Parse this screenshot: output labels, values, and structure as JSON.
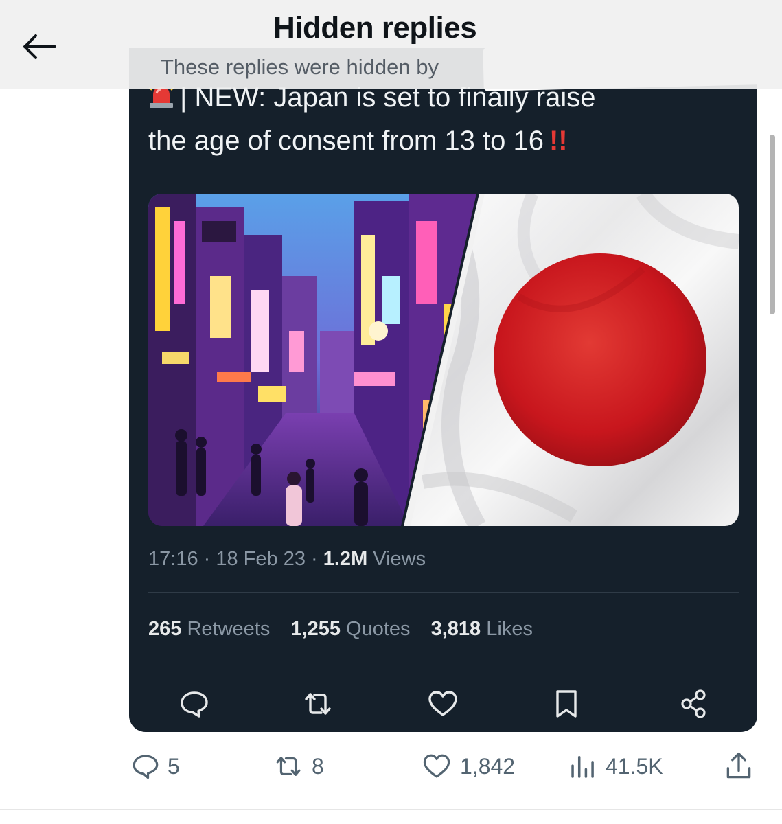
{
  "header": {
    "title": "Hidden replies",
    "subtitle": "These replies were hidden by"
  },
  "tweet": {
    "text_line1": "| NEW: Japan is set to finally raise",
    "text_line2": "the age of consent from 13 to 16",
    "text_emphasis": "!!",
    "time": "17:16",
    "date": "18 Feb 23",
    "views_count": "1.2M",
    "views_label": "Views",
    "retweets_count": "265",
    "retweets_label": "Retweets",
    "quotes_count": "1,255",
    "quotes_label": "Quotes",
    "likes_count": "3,818",
    "likes_label": "Likes"
  },
  "reply_bar": {
    "replies": "5",
    "reposts": "8",
    "likes": "1,842",
    "views": "41.5K"
  },
  "icons": {
    "back": "arrow-left-icon",
    "siren": "rotating-light-icon",
    "reply": "speech-bubble-icon",
    "retweet": "retweet-icon",
    "like": "heart-icon",
    "bookmark": "bookmark-icon",
    "share": "share-icon",
    "views": "bar-chart-icon",
    "upload": "upload-icon"
  },
  "colors": {
    "card_bg": "#15202b",
    "flag_red": "#c8161d",
    "emphasis_red": "#e53935",
    "muted_text": "#8b98a5"
  }
}
